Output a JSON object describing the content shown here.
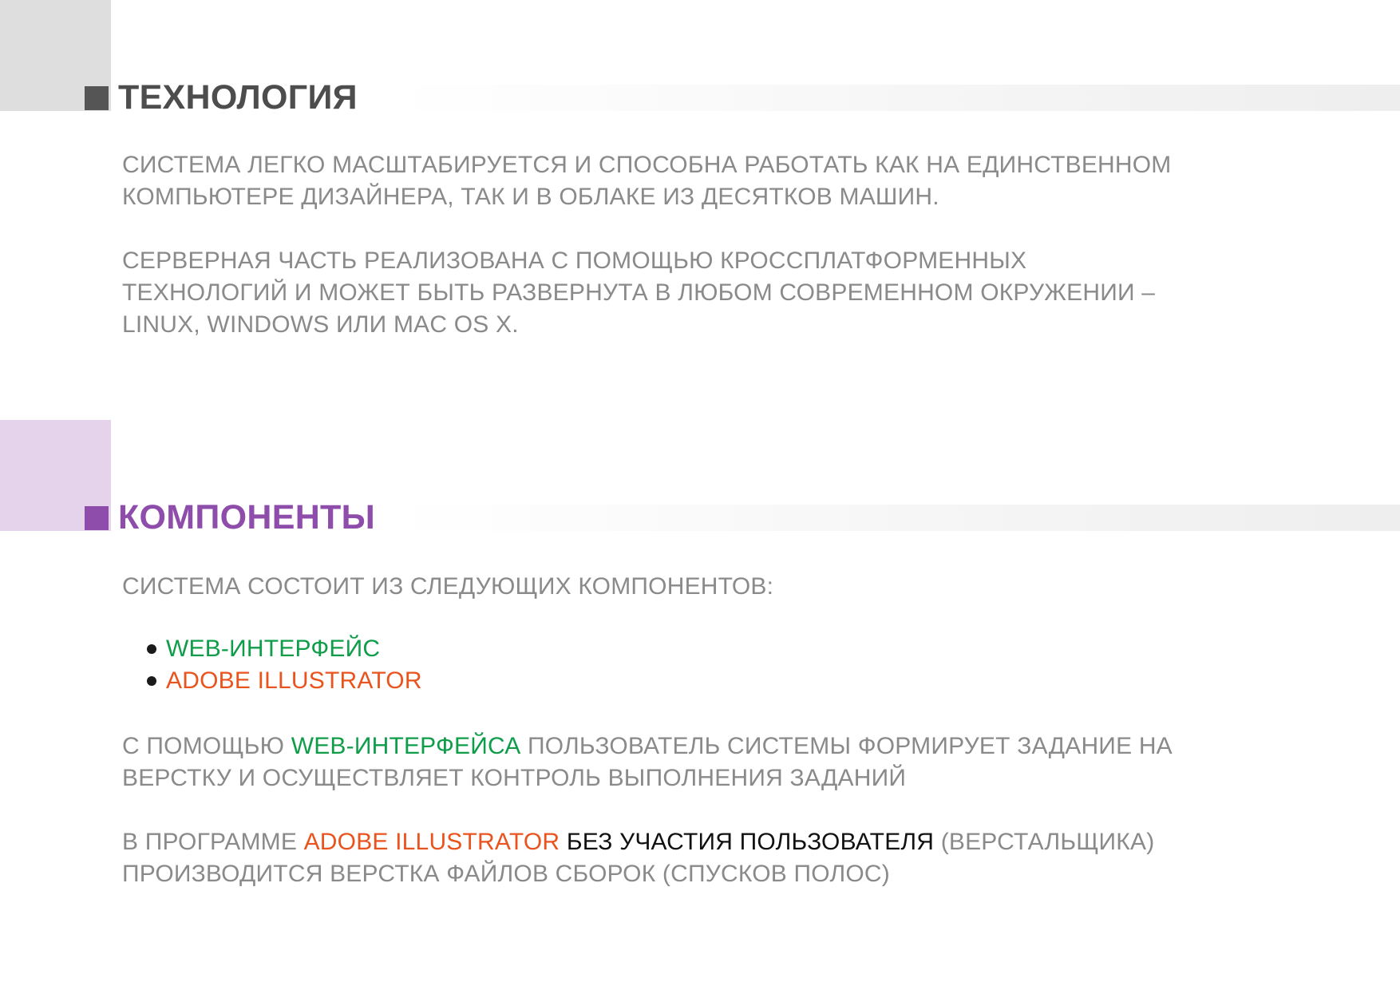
{
  "colors": {
    "body_text": "#8a8a8a",
    "title_gray": "#4d4d4d",
    "title_purple": "#8e4cab",
    "accent_green": "#0f9d4a",
    "accent_orange": "#e9541e",
    "emphasis_black": "#111111",
    "corner_gray": "#dedede",
    "corner_purple": "#e4d3ea"
  },
  "sections": {
    "technology": {
      "title": "ТЕХНОЛОГИЯ",
      "paragraph_1": {
        "line_1": "СИСТЕМА ЛЕГКО МАСШТАБИРУЕТСЯ И СПОСОБНА РАБОТАТЬ КАК НА ЕДИНСТВЕННОМ",
        "line_2": "КОМПЬЮТЕРЕ ДИЗАЙНЕРА, ТАК И В ОБЛАКЕ ИЗ ДЕСЯТКОВ МАШИН."
      },
      "paragraph_2": {
        "line_1": "СЕРВЕРНАЯ ЧАСТЬ РЕАЛИЗОВАНА С ПОМОЩЬЮ КРОССПЛАТФОРМЕННЫХ",
        "line_2": "ТЕХНОЛОГИЙ И МОЖЕТ БЫТЬ РАЗВЕРНУТА В ЛЮБОМ СОВРЕМЕННОМ ОКРУЖЕНИИ –",
        "line_3": "LINUX, WINDOWS ИЛИ MAC OS X."
      }
    },
    "components": {
      "title": "КОМПОНЕНТЫ",
      "intro": "СИСТЕМА СОСТОИТ ИЗ СЛЕДУЮЩИХ КОМПОНЕНТОВ:",
      "list": [
        "WEB-ИНТЕРФЕЙС",
        "ADOBE ILLUSTRATOR"
      ],
      "paragraph_web": {
        "part_1": "С ПОМОЩЬЮ ",
        "highlight": "WEB-ИНТЕРФЕЙСА",
        "part_2": " ПОЛЬЗОВАТЕЛЬ СИСТЕМЫ ФОРМИРУЕТ ЗАДАНИЕ НА",
        "line_2": "ВЕРСТКУ И ОСУЩЕСТВЛЯЕТ КОНТРОЛЬ ВЫПОЛНЕНИЯ ЗАДАНИЙ"
      },
      "paragraph_ai": {
        "part_1": "В ПРОГРАММЕ ",
        "highlight": "ADOBE ILLUSTRATOR",
        "emphasis": " БЕЗ УЧАСТИЯ ПОЛЬЗОВАТЕЛЯ",
        "part_2": " (ВЕРСТАЛЬЩИКА)",
        "line_2": "ПРОИЗВОДИТСЯ ВЕРСТКА ФАЙЛОВ СБОРОК (СПУСКОВ ПОЛОС)"
      }
    }
  }
}
